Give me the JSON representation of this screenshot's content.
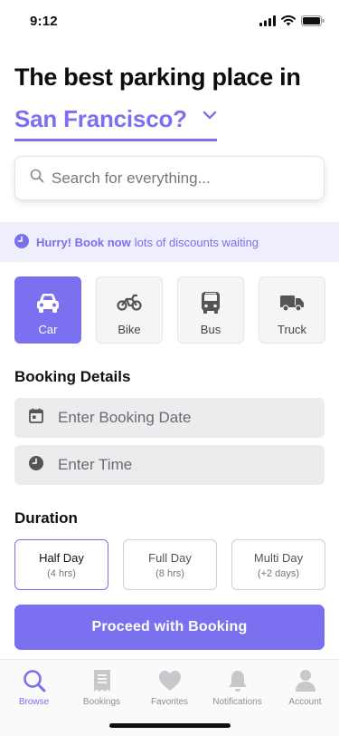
{
  "status_bar": {
    "time": "9:12"
  },
  "header": {
    "headline": "The best parking place in",
    "city": "San Francisco?"
  },
  "search": {
    "placeholder": "Search for everything..."
  },
  "promo": {
    "highlight": "Hurry! Book now",
    "text": "lots of discounts waiting"
  },
  "vehicles": [
    {
      "label": "Car",
      "icon": "car-icon",
      "selected": true
    },
    {
      "label": "Bike",
      "icon": "bike-icon",
      "selected": false
    },
    {
      "label": "Bus",
      "icon": "bus-icon",
      "selected": false
    },
    {
      "label": "Truck",
      "icon": "truck-icon",
      "selected": false
    }
  ],
  "booking": {
    "title": "Booking Details",
    "date_placeholder": "Enter Booking Date",
    "time_placeholder": "Enter Time"
  },
  "duration": {
    "title": "Duration",
    "options": [
      {
        "label": "Half Day",
        "sub": "(4 hrs)",
        "selected": true
      },
      {
        "label": "Full Day",
        "sub": "(8 hrs)",
        "selected": false
      },
      {
        "label": "Multi Day",
        "sub": "(+2 days)",
        "selected": false
      }
    ]
  },
  "proceed_label": "Proceed with Booking",
  "tabs": [
    {
      "label": "Browse",
      "icon": "search-icon",
      "active": true
    },
    {
      "label": "Bookings",
      "icon": "receipt-icon",
      "active": false
    },
    {
      "label": "Favorites",
      "icon": "heart-icon",
      "active": false
    },
    {
      "label": "Notifications",
      "icon": "bell-icon",
      "active": false
    },
    {
      "label": "Account",
      "icon": "person-icon",
      "active": false
    }
  ],
  "colors": {
    "accent": "#7b70f0",
    "promo_background": "#efeefc",
    "field_background": "#ececef",
    "tab_inactive": "#8e8e93"
  }
}
